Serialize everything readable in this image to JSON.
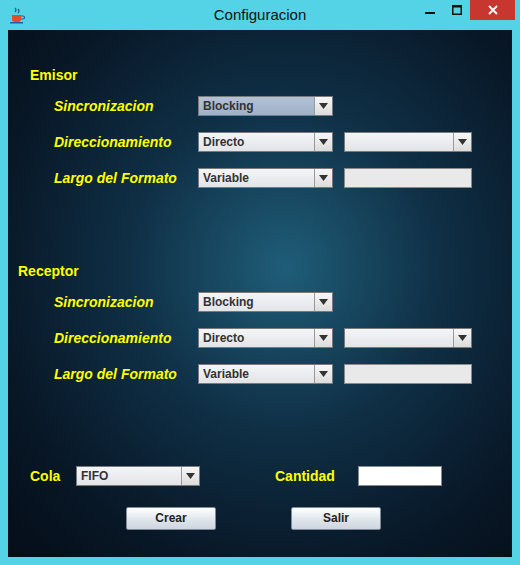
{
  "window": {
    "title": "Configuracion"
  },
  "sections": [
    {
      "title": "Emisor",
      "rows": [
        {
          "label": "Sincronizacion",
          "fields": [
            {
              "kind": "select",
              "value": "Blocking",
              "focused": true
            }
          ]
        },
        {
          "label": "Direccionamiento",
          "fields": [
            {
              "kind": "select",
              "value": "Directo",
              "focused": false
            },
            {
              "kind": "select",
              "value": "",
              "focused": false
            }
          ]
        },
        {
          "label": "Largo del Formato",
          "fields": [
            {
              "kind": "select",
              "value": "Variable",
              "focused": false
            },
            {
              "kind": "text",
              "value": "",
              "disabled": true
            }
          ]
        }
      ]
    },
    {
      "title": "Receptor",
      "rows": [
        {
          "label": "Sincronizacion",
          "fields": [
            {
              "kind": "select",
              "value": "Blocking",
              "focused": false
            }
          ]
        },
        {
          "label": "Direccionamiento",
          "fields": [
            {
              "kind": "select",
              "value": "Directo",
              "focused": false
            },
            {
              "kind": "select",
              "value": "",
              "focused": false
            }
          ]
        },
        {
          "label": "Largo del Formato",
          "fields": [
            {
              "kind": "select",
              "value": "Variable",
              "focused": false
            },
            {
              "kind": "text",
              "value": "",
              "disabled": true
            }
          ]
        }
      ]
    }
  ],
  "queue": {
    "label": "Cola",
    "value": "FIFO",
    "focused": false
  },
  "amount": {
    "label": "Cantidad",
    "value": "",
    "disabled": false
  },
  "buttons": [
    "Crear",
    "Salir"
  ]
}
